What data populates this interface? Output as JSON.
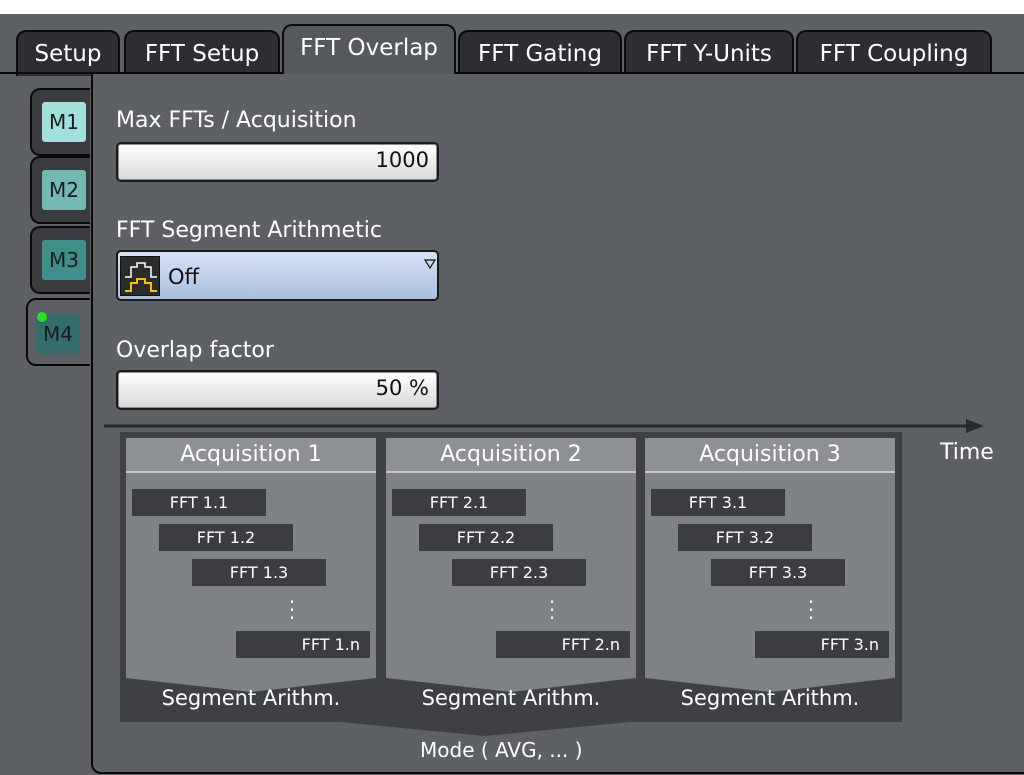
{
  "tabs": [
    {
      "label": "Setup",
      "active": false
    },
    {
      "label": "FFT Setup",
      "active": false
    },
    {
      "label": "FFT Overlap",
      "active": true
    },
    {
      "label": "FFT Gating",
      "active": false
    },
    {
      "label": "FFT Y-Units",
      "active": false
    },
    {
      "label": "FFT Coupling",
      "active": false
    }
  ],
  "math_channels": [
    {
      "label": "M1",
      "color": "#a4e0db"
    },
    {
      "label": "M2",
      "color": "#74b9b4"
    },
    {
      "label": "M3",
      "color": "#3f8e89"
    },
    {
      "label": "M4",
      "color": "#346d6c",
      "active": true,
      "indicator_color": "#28e028"
    }
  ],
  "max_ffts": {
    "label": "Max FFTs / Acquisition",
    "value": "1000"
  },
  "segment_arithmetic": {
    "label": "FFT Segment Arithmetic",
    "value": "Off",
    "icon": "segment-arithmetic-icon",
    "dropdown_icon": "dropdown-triangle-icon"
  },
  "overlap": {
    "label": "Overlap factor",
    "value": "50 %"
  },
  "diagram": {
    "time_label": "Time",
    "acquisitions": [
      {
        "title": "Acquisition 1",
        "ffts": [
          "FFT 1.1",
          "FFT 1.2",
          "FFT 1.3",
          "FFT 1.n"
        ],
        "footer": "Segment Arithm."
      },
      {
        "title": "Acquisition 2",
        "ffts": [
          "FFT 2.1",
          "FFT 2.2",
          "FFT 2.3",
          "FFT 2.n"
        ],
        "footer": "Segment Arithm."
      },
      {
        "title": "Acquisition 3",
        "ffts": [
          "FFT 3.1",
          "FFT 3.2",
          "FFT 3.3",
          "FFT 3.n"
        ],
        "footer": "Segment Arithm."
      }
    ],
    "mode_label": "Mode ( AVG, ... )"
  },
  "colors": {
    "panel": "#5d6064",
    "tab_inactive": "#2c2e31",
    "combo": "#b7cae4"
  }
}
